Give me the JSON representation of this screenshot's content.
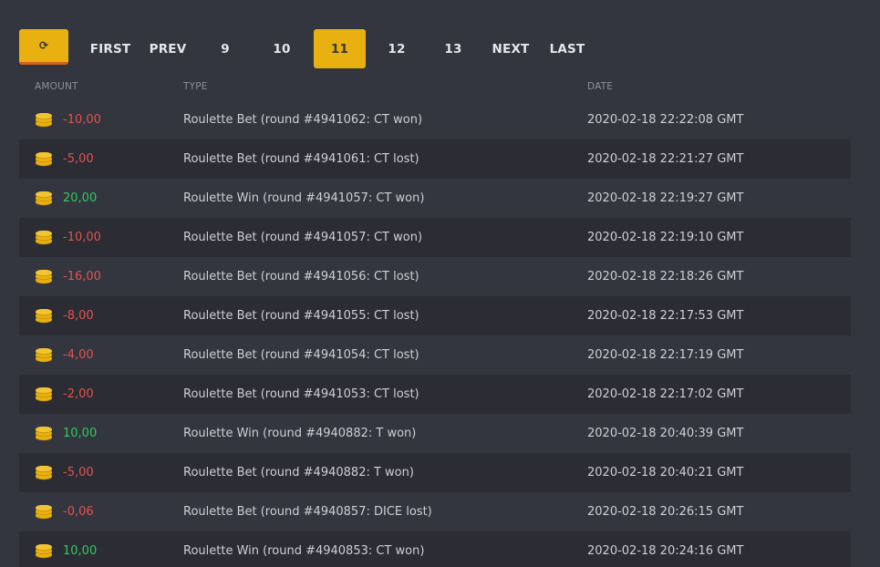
{
  "pagination": {
    "refresh_icon": "refresh-icon",
    "refresh_glyph": "⟳",
    "first": "FIRST",
    "prev": "PREV",
    "pages": [
      "9",
      "10",
      "11",
      "12",
      "13"
    ],
    "active_page": "11",
    "next": "NEXT",
    "last": "LAST"
  },
  "table": {
    "headers": {
      "amount": "AMOUNT",
      "type": "TYPE",
      "date": "DATE"
    },
    "rows": [
      {
        "amount": "-10,00",
        "sign": "neg",
        "type": "Roulette Bet (round #4941062: CT won)",
        "date": "2020-02-18 22:22:08 GMT"
      },
      {
        "amount": "-5,00",
        "sign": "neg",
        "type": "Roulette Bet (round #4941061: CT lost)",
        "date": "2020-02-18 22:21:27 GMT"
      },
      {
        "amount": "20,00",
        "sign": "pos",
        "type": "Roulette Win (round #4941057: CT won)",
        "date": "2020-02-18 22:19:27 GMT"
      },
      {
        "amount": "-10,00",
        "sign": "neg",
        "type": "Roulette Bet (round #4941057: CT won)",
        "date": "2020-02-18 22:19:10 GMT"
      },
      {
        "amount": "-16,00",
        "sign": "neg",
        "type": "Roulette Bet (round #4941056: CT lost)",
        "date": "2020-02-18 22:18:26 GMT"
      },
      {
        "amount": "-8,00",
        "sign": "neg",
        "type": "Roulette Bet (round #4941055: CT lost)",
        "date": "2020-02-18 22:17:53 GMT"
      },
      {
        "amount": "-4,00",
        "sign": "neg",
        "type": "Roulette Bet (round #4941054: CT lost)",
        "date": "2020-02-18 22:17:19 GMT"
      },
      {
        "amount": "-2,00",
        "sign": "neg",
        "type": "Roulette Bet (round #4941053: CT lost)",
        "date": "2020-02-18 22:17:02 GMT"
      },
      {
        "amount": "10,00",
        "sign": "pos",
        "type": "Roulette Win (round #4940882: T won)",
        "date": "2020-02-18 20:40:39 GMT"
      },
      {
        "amount": "-5,00",
        "sign": "neg",
        "type": "Roulette Bet (round #4940882: T won)",
        "date": "2020-02-18 20:40:21 GMT"
      },
      {
        "amount": "-0,06",
        "sign": "neg",
        "type": "Roulette Bet (round #4940857: DICE lost)",
        "date": "2020-02-18 20:26:15 GMT"
      },
      {
        "amount": "10,00",
        "sign": "pos",
        "type": "Roulette Win (round #4940853: CT won)",
        "date": "2020-02-18 20:24:16 GMT"
      }
    ]
  },
  "colors": {
    "background": "#33353f",
    "row_alt": "#2b2c34",
    "accent": "#e8b10f",
    "negative": "#e0544e",
    "positive": "#2fce5a"
  },
  "icons": {
    "coin": "coins-icon"
  }
}
